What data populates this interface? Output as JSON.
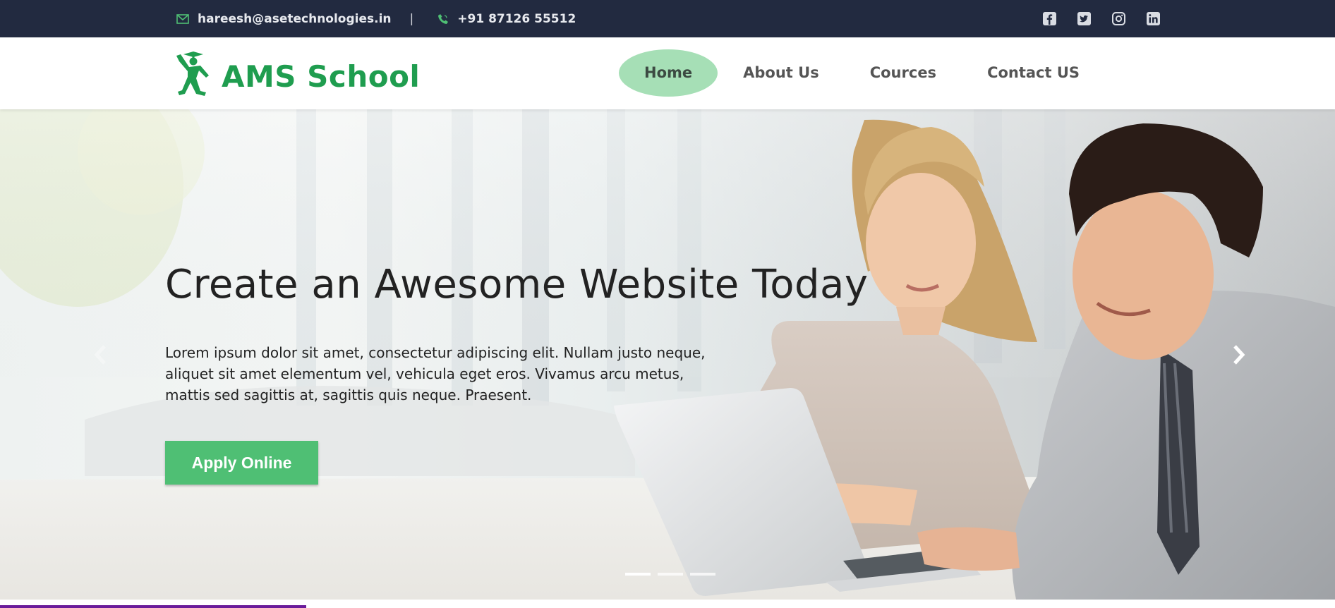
{
  "topbar": {
    "email": "hareesh@asetechnologies.in",
    "separator": "|",
    "phone": "+91 87126 55512",
    "email_icon": "envelope-icon",
    "phone_icon": "phone-icon",
    "social": [
      "facebook-icon",
      "twitter-icon",
      "instagram-icon",
      "linkedin-icon"
    ],
    "icon_color": "#4fbf74"
  },
  "header": {
    "brand": "AMS School",
    "brand_color": "#1f9d4f",
    "nav": [
      {
        "label": "Home",
        "active": true
      },
      {
        "label": "About Us",
        "active": false
      },
      {
        "label": "Cources",
        "active": false
      },
      {
        "label": "Contact US",
        "active": false
      }
    ]
  },
  "hero": {
    "title": "Create an Awesome Website Today",
    "description": "Lorem ipsum dolor sit amet, consectetur adipiscing elit. Nullam justo neque, aliquet sit amet elementum vel, vehicula eget eros. Vivamus arcu metus, mattis sed sagittis at, sagittis quis neque. Praesent.",
    "button": "Apply Online",
    "button_color": "#4fbf74",
    "slides": 3,
    "active_slide": 1
  }
}
